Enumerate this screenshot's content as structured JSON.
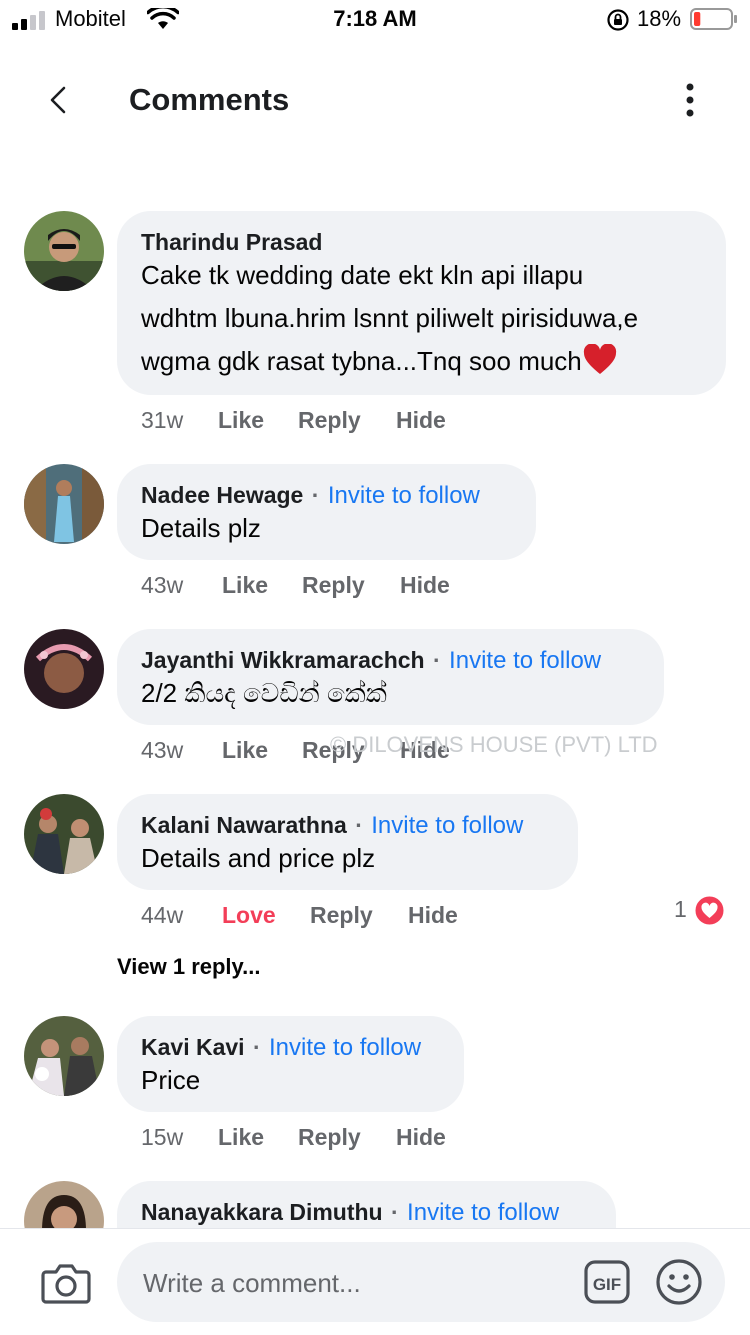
{
  "status_bar": {
    "carrier": "Mobitel",
    "time": "7:18 AM",
    "battery_percent": "18%",
    "battery_level": 0.18,
    "signal_bars": 2
  },
  "header": {
    "title": "Comments",
    "back_icon": "chevron-left-icon",
    "more_icon": "more-vertical-icon"
  },
  "comments": [
    {
      "name": "Tharindu Prasad",
      "invite": "",
      "text": [
        "Cake tk wedding date ekt kln api illapu",
        "wdhtm lbuna.hrim lsnnt piliwelt pirisiduwa,e",
        "wgma gdk rasat tybna...Tnq soo much"
      ],
      "time": "31w",
      "like": "Like",
      "reply": "Reply",
      "hide": "Hide"
    },
    {
      "name": "Nadee Hewage",
      "invite": "Invite to follow",
      "text": [
        "Details plz"
      ],
      "time": "43w",
      "like": "Like",
      "reply": "Reply",
      "hide": "Hide"
    },
    {
      "name": "Jayanthi Wikkramarachch",
      "invite": "Invite to follow",
      "text": [
        "2/2 කියද වෙඩින් කේක්"
      ],
      "time": "43w",
      "like": "Like",
      "reply": "Reply",
      "hide": "Hide"
    },
    {
      "name": "Kalani Nawarathna",
      "invite": "Invite to follow",
      "text": [
        "Details and price plz"
      ],
      "time": "44w",
      "like": "Love",
      "reply": "Reply",
      "hide": "Hide",
      "reaction_count": "1",
      "view_replies": "View 1 reply..."
    },
    {
      "name": "Kavi Kavi",
      "invite": "Invite to follow",
      "text": [
        "Price"
      ],
      "time": "15w",
      "like": "Like",
      "reply": "Reply",
      "hide": "Hide"
    },
    {
      "name": "Nanayakkara Dimuthu",
      "invite": "Invite to follow",
      "text": [],
      "time": "",
      "like": "",
      "reply": "",
      "hide": ""
    }
  ],
  "watermark": "© DILOVENS HOUSE (PVT) LTD",
  "composer": {
    "placeholder": "Write a comment...",
    "camera_icon": "camera-icon",
    "gif_icon": "gif-icon",
    "emoji_icon": "emoji-icon"
  },
  "colors": {
    "link_blue": "#1877f2",
    "love_red": "#f33e58",
    "bubble_gray": "#f0f2f5",
    "secondary_text": "#65676b"
  }
}
